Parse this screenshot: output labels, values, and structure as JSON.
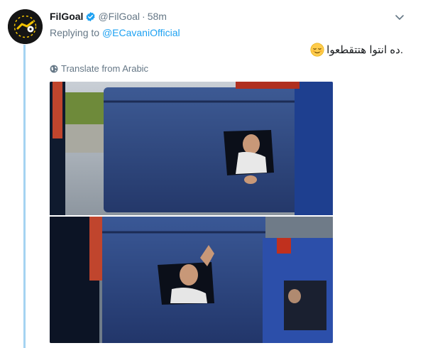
{
  "tweet": {
    "display_name": "FilGoal",
    "handle": "@FilGoal",
    "separator": "·",
    "time": "58m",
    "replying_prefix": "Replying to",
    "replying_to": "@ECavaniOfficial",
    "text": ".ده انتوا هتتقطعوا",
    "translate_label": "Translate from Arabic"
  },
  "icons": {
    "verified": "verified-badge-icon",
    "caret": "chevron-down-icon",
    "translate": "globe-icon",
    "emoji": "relieved-face-emoji"
  },
  "colors": {
    "link": "#1da1f2",
    "secondary_text": "#657786",
    "thread_line": "#a5d3f1",
    "verified": "#1da1f2"
  }
}
